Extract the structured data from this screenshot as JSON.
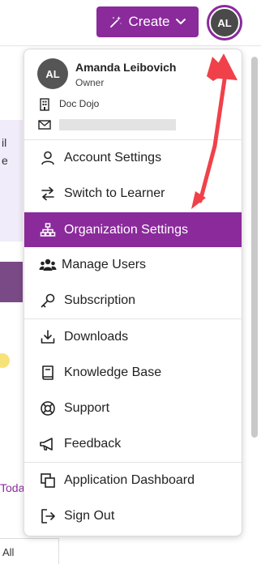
{
  "header": {
    "create_label": "Create",
    "avatar_initials": "AL"
  },
  "background_fragments": {
    "frag1": "il",
    "frag2": "e",
    "frag3": "Toda",
    "frag4": "All"
  },
  "profile": {
    "initials": "AL",
    "name": "Amanda Leibovich",
    "role": "Owner",
    "org": "Doc Dojo"
  },
  "menu": {
    "items": [
      {
        "label": "Account Settings",
        "icon": "person-icon"
      },
      {
        "label": "Switch to Learner",
        "icon": "swap-arrows-icon"
      },
      {
        "label": "Organization Settings",
        "icon": "org-chart-icon",
        "active": true
      },
      {
        "label": "Manage Users",
        "icon": "users-icon"
      },
      {
        "label": "Subscription",
        "icon": "key-icon"
      },
      {
        "label": "Downloads",
        "icon": "download-icon"
      },
      {
        "label": "Knowledge Base",
        "icon": "book-icon"
      },
      {
        "label": "Support",
        "icon": "lifebuoy-icon"
      },
      {
        "label": "Feedback",
        "icon": "megaphone-icon"
      },
      {
        "label": "Application Dashboard",
        "icon": "copy-icon"
      },
      {
        "label": "Sign Out",
        "icon": "sign-out-icon"
      }
    ]
  },
  "colors": {
    "brand_purple": "#8a2a9b",
    "annotation_red": "#f0414a"
  }
}
